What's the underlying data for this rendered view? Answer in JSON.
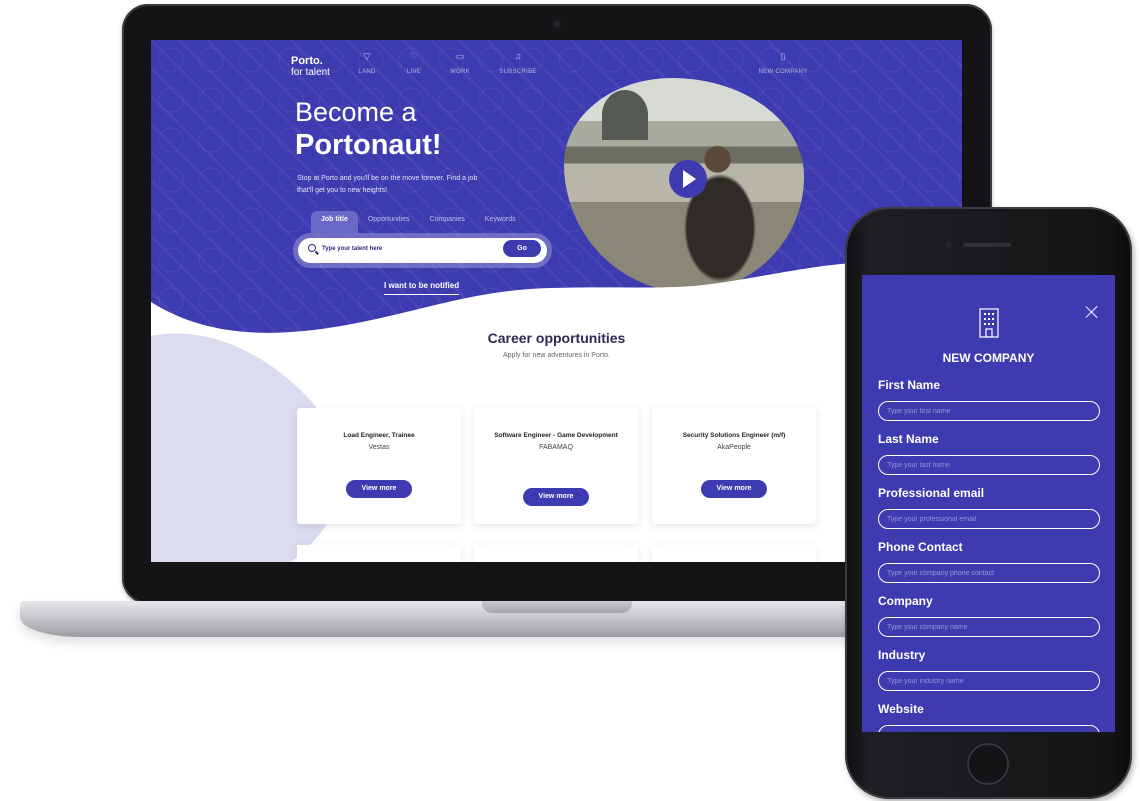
{
  "laptop": {
    "brand": {
      "name": "Porto.",
      "sub": "for talent"
    },
    "nav": [
      {
        "icon": "land-icon",
        "label": "LAND"
      },
      {
        "icon": "heart-icon",
        "label": "LIVE"
      },
      {
        "icon": "monitor-icon",
        "label": "WORK"
      },
      {
        "icon": "bell-icon",
        "label": "SUBSCRIBE"
      },
      {
        "icon": "building-icon",
        "label": "NEW COMPANY"
      }
    ],
    "hero": {
      "title": "Become a",
      "title_bold": "Portonaut!",
      "subtitle": "Stop at Porto and you'll be on the move forever. Find a job that'll get you to new heights!"
    },
    "search": {
      "tabs": [
        "Job title",
        "Opportunities",
        "Companies",
        "Keywords"
      ],
      "active_tab": "Job title",
      "placeholder": "Type your talent here",
      "go_label": "Go"
    },
    "notify_label": "I want to be notified",
    "section": {
      "title": "Career opportunities",
      "subtitle": "Apply for new adventures in Porto."
    },
    "jobs": [
      {
        "title": "Load Engineer, Trainee",
        "company": "Vestas",
        "button": "View more"
      },
      {
        "title": "Software Engineer - Game Development",
        "company": "FABAMAQ",
        "button": "View more"
      },
      {
        "title": "Security Solutions Engineer (m/f)",
        "company": "AkaPeople",
        "button": "View more"
      }
    ],
    "colors": {
      "primary": "#3d3bb0",
      "dark_text": "#2d2b55",
      "accent_light": "#dcdcf0"
    }
  },
  "phone": {
    "heading": "NEW COMPANY",
    "fields": [
      {
        "label": "First Name",
        "placeholder": "Type your first name"
      },
      {
        "label": "Last Name",
        "placeholder": "Type your last name"
      },
      {
        "label": "Professional email",
        "placeholder": "Type your professional email"
      },
      {
        "label": "Phone Contact",
        "placeholder": "Type your company phone contact"
      },
      {
        "label": "Company",
        "placeholder": "Type your company name"
      },
      {
        "label": "Industry",
        "placeholder": "Type your industry name"
      },
      {
        "label": "Website",
        "placeholder": ""
      }
    ]
  }
}
